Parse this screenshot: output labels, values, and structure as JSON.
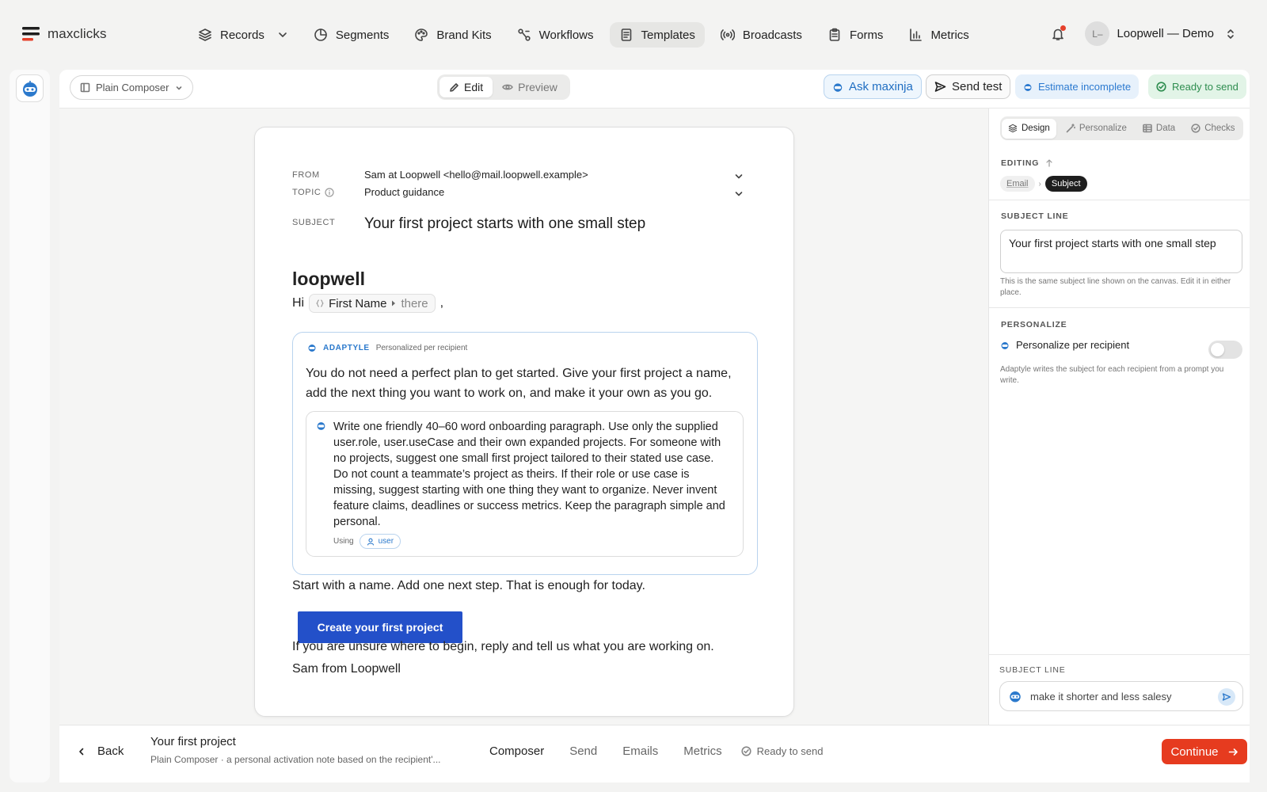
{
  "brand": {
    "name": "maxclicks"
  },
  "nav": {
    "items": [
      {
        "label": "Records"
      },
      {
        "label": "Segments"
      },
      {
        "label": "Brand Kits"
      },
      {
        "label": "Workflows"
      },
      {
        "label": "Templates"
      },
      {
        "label": "Broadcasts"
      },
      {
        "label": "Forms"
      },
      {
        "label": "Metrics"
      }
    ],
    "active": "Templates"
  },
  "account": {
    "initials": "L–",
    "name": "Loopwell — Demo"
  },
  "toolbar": {
    "composer": "Plain Composer",
    "edit": "Edit",
    "preview": "Preview",
    "ask": "Ask maxinja",
    "send_test": "Send test",
    "estimate": "Estimate incomplete",
    "ready": "Ready to send"
  },
  "email": {
    "from_label": "FROM",
    "from_value": "Sam at Loopwell <hello@mail.loopwell.example>",
    "topic_label": "TOPIC",
    "topic_value": "Product guidance",
    "subject_label": "SUBJECT",
    "subject_value": "Your first project starts with one small step",
    "logo": "loopwell",
    "greeting": "Hi",
    "token_name": "First Name",
    "token_fallback": "there",
    "greeting_end": ",",
    "adaptyle_name": "ADAPTYLE",
    "adaptyle_sub": "Personalized per recipient",
    "adaptyle_para": "You do not need a perfect plan to get started. Give your first project a name, add the next thing you want to work on, and make it your own as you go.",
    "prompt": "Write one friendly 40–60 word onboarding paragraph. Use only the supplied user.role, user.useCase and their own expanded projects. For someone with no projects, suggest one small first project tailored to their stated use case. Do not count a teammate’s project as theirs. If their role or use case is missing, suggest starting with one thing they want to organize. Never invent feature claims, deadlines or success metrics. Keep the paragraph simple and personal.",
    "using_label": "Using",
    "using_chip": "user",
    "line1": "Start with a name. Add one next step. That is enough for today.",
    "cta": "Create your first project",
    "line2": "If you are unsure where to begin, reply and tell us what you are working on.",
    "signoff": "Sam from Loopwell"
  },
  "panel": {
    "tabs": [
      "Design",
      "Personalize",
      "Data",
      "Checks"
    ],
    "editing_label": "EDITING",
    "crumb_email": "Email",
    "crumb_subject": "Subject",
    "subject_line_label": "SUBJECT LINE",
    "subject_line_value": "Your first project starts with one small step",
    "subject_help": "This is the same subject line shown on the canvas. Edit it in either place.",
    "personalize_label": "PERSONALIZE",
    "personalize_row": "Personalize per recipient",
    "personalize_on": false,
    "personalize_help": "Adaptyle writes the subject for each recipient from a prompt you write.",
    "chat_label": "SUBJECT LINE",
    "chat_value": "make it shorter and less salesy"
  },
  "bottom": {
    "back": "Back",
    "title": "Your first project",
    "subtitle": "Plain Composer · a personal activation note based on the recipient'...",
    "tabs": [
      "Composer",
      "Send",
      "Emails",
      "Metrics"
    ],
    "status": "Ready to send",
    "continue": "Continue"
  },
  "colors": {
    "primary_cta": "#2350c9",
    "continue": "#e63b1f",
    "adaptyle": "#2b79cc",
    "ready_green": "#2e8d4f"
  }
}
